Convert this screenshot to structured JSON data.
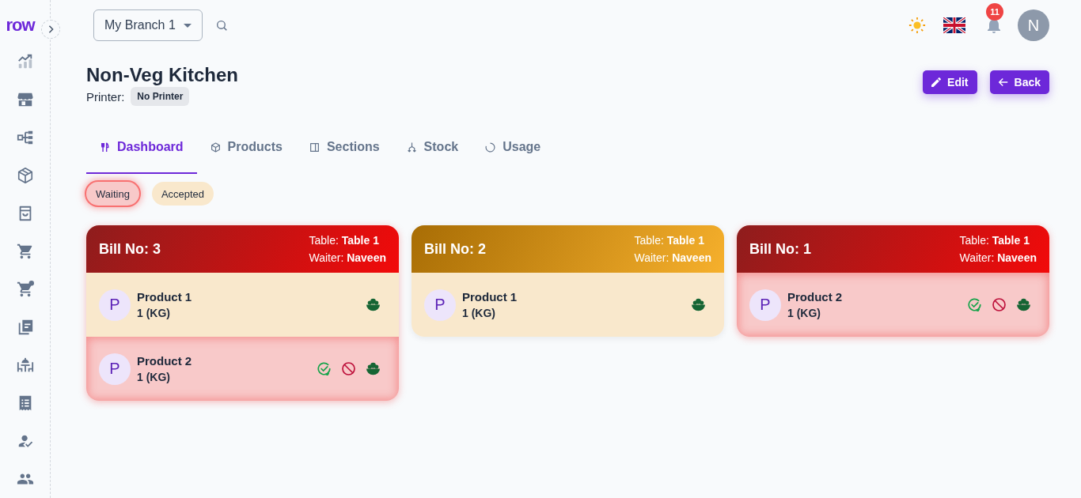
{
  "sidebar": {
    "logo": "row",
    "items": [
      {
        "kind": "chart"
      },
      {
        "kind": "store"
      },
      {
        "kind": "hierarchy"
      },
      {
        "kind": "box"
      },
      {
        "kind": "bag"
      },
      {
        "kind": "cart"
      },
      {
        "kind": "cart-add"
      },
      {
        "kind": "receipts"
      },
      {
        "kind": "dining"
      },
      {
        "kind": "receipt"
      },
      {
        "kind": "user-check"
      },
      {
        "kind": "users"
      }
    ]
  },
  "topbar": {
    "branch": "My Branch 1",
    "notifications": "11",
    "avatar": "N"
  },
  "header": {
    "title": "Non-Veg Kitchen",
    "printer_label": "Printer:",
    "printer": "No Printer",
    "buttons": [
      {
        "kind": "edit",
        "label": "Edit"
      },
      {
        "kind": "back",
        "label": "Back"
      }
    ]
  },
  "tabs": [
    {
      "kind": "dashboard",
      "label": "Dashboard",
      "selected": true
    },
    {
      "kind": "products",
      "label": "Products",
      "selected": false
    },
    {
      "kind": "sections",
      "label": "Sections",
      "selected": false
    },
    {
      "kind": "stock",
      "label": "Stock",
      "selected": false
    },
    {
      "kind": "usage",
      "label": "Usage",
      "selected": false
    }
  ],
  "filters": [
    {
      "label": "Waiting",
      "selected": true,
      "color": "#f8c9c9"
    },
    {
      "label": "Accepted",
      "selected": false,
      "color": "#f9e8cc"
    }
  ],
  "bills": [
    {
      "title": "Bill No: 3",
      "kind": "waiting",
      "table": "Table: **Table 1**",
      "waiter": "Waiter: **Naveen**",
      "items": [
        {
          "initial": "P",
          "name": "Product 1",
          "qty": "1 (KG)",
          "kind": "accepted",
          "actions": [
            {
              "kind": "serve"
            }
          ]
        },
        {
          "initial": "P",
          "name": "Product 2",
          "qty": "1 (KG)",
          "kind": "waiting",
          "actions": [
            {
              "kind": "accept"
            },
            {
              "kind": "reject"
            },
            {
              "kind": "serve"
            }
          ]
        }
      ]
    },
    {
      "title": "Bill No: 2",
      "kind": "accepted",
      "table": "Table: **Table 1**",
      "waiter": "Waiter: **Naveen**",
      "items": [
        {
          "initial": "P",
          "name": "Product 1",
          "qty": "1 (KG)",
          "kind": "accepted",
          "actions": [
            {
              "kind": "serve"
            }
          ]
        }
      ]
    },
    {
      "title": "Bill No: 1",
      "kind": "waiting",
      "table": "Table: **Table 1**",
      "waiter": "Waiter: **Naveen**",
      "items": [
        {
          "initial": "P",
          "name": "Product 2",
          "qty": "1 (KG)",
          "kind": "waiting",
          "actions": [
            {
              "kind": "accept"
            },
            {
              "kind": "reject"
            },
            {
              "kind": "serve"
            }
          ]
        }
      ]
    }
  ]
}
